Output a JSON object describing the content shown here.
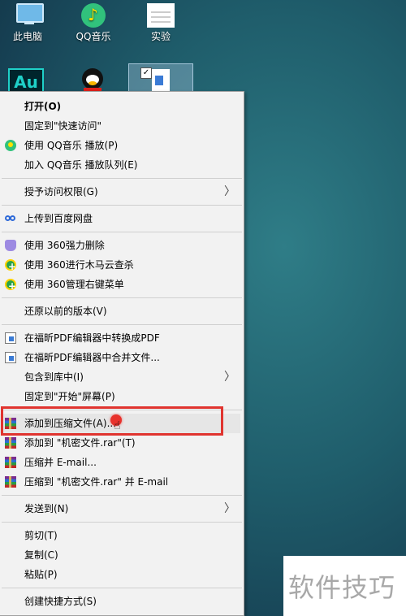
{
  "desktop": {
    "icons": [
      {
        "label": "此电脑"
      },
      {
        "label": "QQ音乐"
      },
      {
        "label": "实验"
      }
    ],
    "au_icon_text": "Au"
  },
  "context_menu": {
    "items": [
      {
        "label": "打开(O)"
      },
      {
        "label": "固定到\"快速访问\""
      },
      {
        "label": "使用 QQ音乐 播放(P)"
      },
      {
        "label": "加入 QQ音乐 播放队列(E)"
      },
      {
        "label": "授予访问权限(G)"
      },
      {
        "label": "上传到百度网盘"
      },
      {
        "label": "使用 360强力删除"
      },
      {
        "label": "使用 360进行木马云查杀"
      },
      {
        "label": "使用 360管理右键菜单"
      },
      {
        "label": "还原以前的版本(V)"
      },
      {
        "label": "在福昕PDF编辑器中转换成PDF"
      },
      {
        "label": "在福昕PDF编辑器中合并文件..."
      },
      {
        "label": "包含到库中(I)"
      },
      {
        "label": "固定到\"开始\"屏幕(P)"
      },
      {
        "label": "添加到压缩文件(A)..."
      },
      {
        "label": "添加到 \"机密文件.rar\"(T)"
      },
      {
        "label": "压缩并 E-mail..."
      },
      {
        "label": "压缩到 \"机密文件.rar\" 并 E-mail"
      },
      {
        "label": "发送到(N)"
      },
      {
        "label": "剪切(T)"
      },
      {
        "label": "复制(C)"
      },
      {
        "label": "粘贴(P)"
      },
      {
        "label": "创建快捷方式(S)"
      }
    ],
    "submenu_arrow": "〉"
  },
  "watermark": {
    "text": "软件技巧"
  },
  "colors": {
    "highlight": "#e0342f",
    "menu_bg": "#f2f2f2"
  }
}
